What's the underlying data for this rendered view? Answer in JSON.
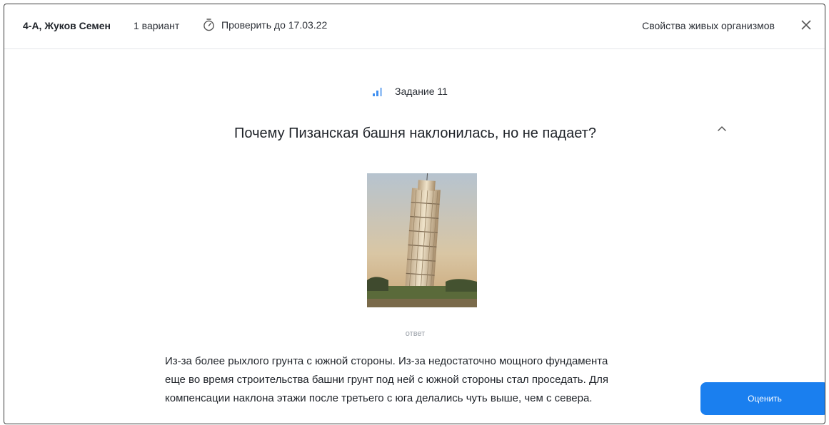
{
  "header": {
    "student": "4-А, Жуков Семен",
    "variant": "1 вариант",
    "deadline": "Проверить до 17.03.22",
    "topic": "Свойства живых организмов",
    "icons": {
      "deadline": "stopwatch-icon",
      "close": "close-icon"
    }
  },
  "task": {
    "label": "Задание 11",
    "difficulty_icon": "difficulty-bars-icon",
    "question": "Почему Пизанская башня наклонилась, но не падает?",
    "collapse_icon": "chevron-up-icon",
    "image": "leaning-tower-of-pisa-photo"
  },
  "answer": {
    "label": "ответ",
    "lines": [
      "Из-за более рыхлого грунта с южной стороны. Из-за недостаточно мощного фундамента",
      "еще во время строительства башни грунт под ней с южной стороны стал проседать. Для",
      "компенсации наклона этажи после третьего с юга делались чуть выше, чем с севера."
    ]
  },
  "actions": {
    "rate_label": "Оценить"
  },
  "colors": {
    "accent": "#1a7fef",
    "divider": "#e4e6ea",
    "muted": "#9aa0a8"
  }
}
